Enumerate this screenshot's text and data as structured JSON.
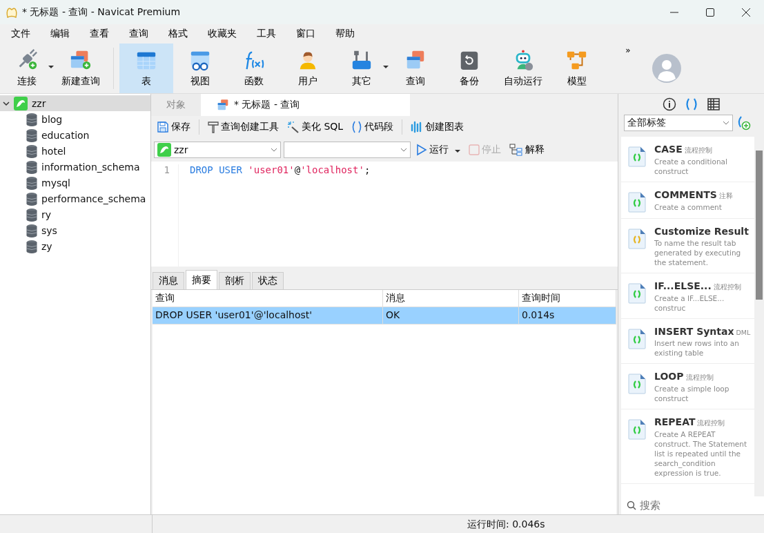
{
  "window": {
    "title": "* 无标题 - 查询 - Navicat Premium"
  },
  "menu": [
    "文件",
    "编辑",
    "查看",
    "查询",
    "格式",
    "收藏夹",
    "工具",
    "窗口",
    "帮助"
  ],
  "toolbar": [
    {
      "label": "连接",
      "selected": false,
      "dropdown": true
    },
    {
      "label": "新建查询",
      "selected": false,
      "dropdown": false
    },
    {
      "label": "表",
      "selected": true,
      "dropdown": false
    },
    {
      "label": "视图",
      "selected": false,
      "dropdown": false
    },
    {
      "label": "函数",
      "selected": false,
      "dropdown": false
    },
    {
      "label": "用户",
      "selected": false,
      "dropdown": false
    },
    {
      "label": "其它",
      "selected": false,
      "dropdown": true
    },
    {
      "label": "查询",
      "selected": false,
      "dropdown": false
    },
    {
      "label": "备份",
      "selected": false,
      "dropdown": false
    },
    {
      "label": "自动运行",
      "selected": false,
      "dropdown": false
    },
    {
      "label": "模型",
      "selected": false,
      "dropdown": false
    }
  ],
  "toolbar_more": "»",
  "sidebar": {
    "items": [
      {
        "label": "zzr",
        "selected": true,
        "expanded": true,
        "children": [
          {
            "label": "blog",
            "selected": false
          },
          {
            "label": "education",
            "selected": false
          },
          {
            "label": "hotel",
            "selected": false
          },
          {
            "label": "information_schema",
            "selected": false
          },
          {
            "label": "mysql",
            "selected": false
          },
          {
            "label": "performance_schema",
            "selected": false
          },
          {
            "label": "ry",
            "selected": false
          },
          {
            "label": "sys",
            "selected": false
          },
          {
            "label": "zy",
            "selected": false
          }
        ]
      }
    ]
  },
  "tabs": [
    {
      "label": "对象",
      "selected": false
    },
    {
      "label": "* 无标题 - 查询",
      "selected": true
    }
  ],
  "query_toolbar": [
    "保存",
    "查询创建工具",
    "美化 SQL",
    "代码段",
    "创建图表"
  ],
  "connection_select": {
    "value": "zzr"
  },
  "run_controls": [
    {
      "label": "运行",
      "disabled": false,
      "dropdown": true
    },
    {
      "label": "停止",
      "disabled": true,
      "dropdown": false
    },
    {
      "label": "解释",
      "disabled": false,
      "dropdown": false
    }
  ],
  "editor": {
    "lines": [
      {
        "number": "1",
        "tokens": [
          {
            "kind": "keyword",
            "text": "DROP"
          },
          {
            "kind": "keyword",
            "text": "USER"
          },
          {
            "kind": "string",
            "text": "'user01'"
          },
          {
            "kind": "plain",
            "text": "@"
          },
          {
            "kind": "string",
            "text": "'localhost'"
          },
          {
            "kind": "plain",
            "text": ";"
          }
        ]
      }
    ]
  },
  "result_tabs": [
    {
      "label": "消息",
      "selected": false
    },
    {
      "label": "摘要",
      "selected": true
    },
    {
      "label": "剖析",
      "selected": false
    },
    {
      "label": "状态",
      "selected": false
    }
  ],
  "table": {
    "columns": [
      "查询",
      "消息",
      "查询时间"
    ],
    "rows": [
      {
        "selected": true,
        "cells": [
          "DROP USER 'user01'@'localhost'",
          "OK",
          "0.014s"
        ]
      }
    ]
  },
  "snippets_panel": {
    "tabs": [
      {
        "kind": "info",
        "selected": false
      },
      {
        "kind": "snippets",
        "selected": true
      },
      {
        "kind": "grid",
        "selected": false
      }
    ],
    "filter": "全部标签",
    "items": [
      {
        "title": "CASE",
        "tag": "流程控制",
        "description": "Create a conditional construct",
        "color": "#2ecc40"
      },
      {
        "title": "COMMENTS",
        "tag": "注释",
        "description": "Create a comment",
        "color": "#2ecc40"
      },
      {
        "title": "Customize Result",
        "description": "To name the result tab generated by executing the statement.",
        "color": "#e6b422"
      },
      {
        "title": "IF...ELSE...",
        "tag": "流程控制",
        "description": "Create a IF...ELSE... construc",
        "color": "#2ecc40"
      },
      {
        "title": "INSERT Syntax",
        "tag": "DML",
        "description": "Insert new rows into an existing table",
        "color": "#2ecc40"
      },
      {
        "title": "LOOP",
        "tag": "流程控制",
        "description": "Create a simple loop construct",
        "color": "#2ecc40"
      },
      {
        "title": "REPEAT",
        "tag": "流程控制",
        "description": "Create A REPEAT construct. The Statement list is repeated until the search_condition expression is true.",
        "color": "#2ecc40"
      }
    ],
    "search": {
      "placeholder": "搜索"
    }
  },
  "status_bar": {
    "elapsed": "运行时间: 0.046s"
  }
}
